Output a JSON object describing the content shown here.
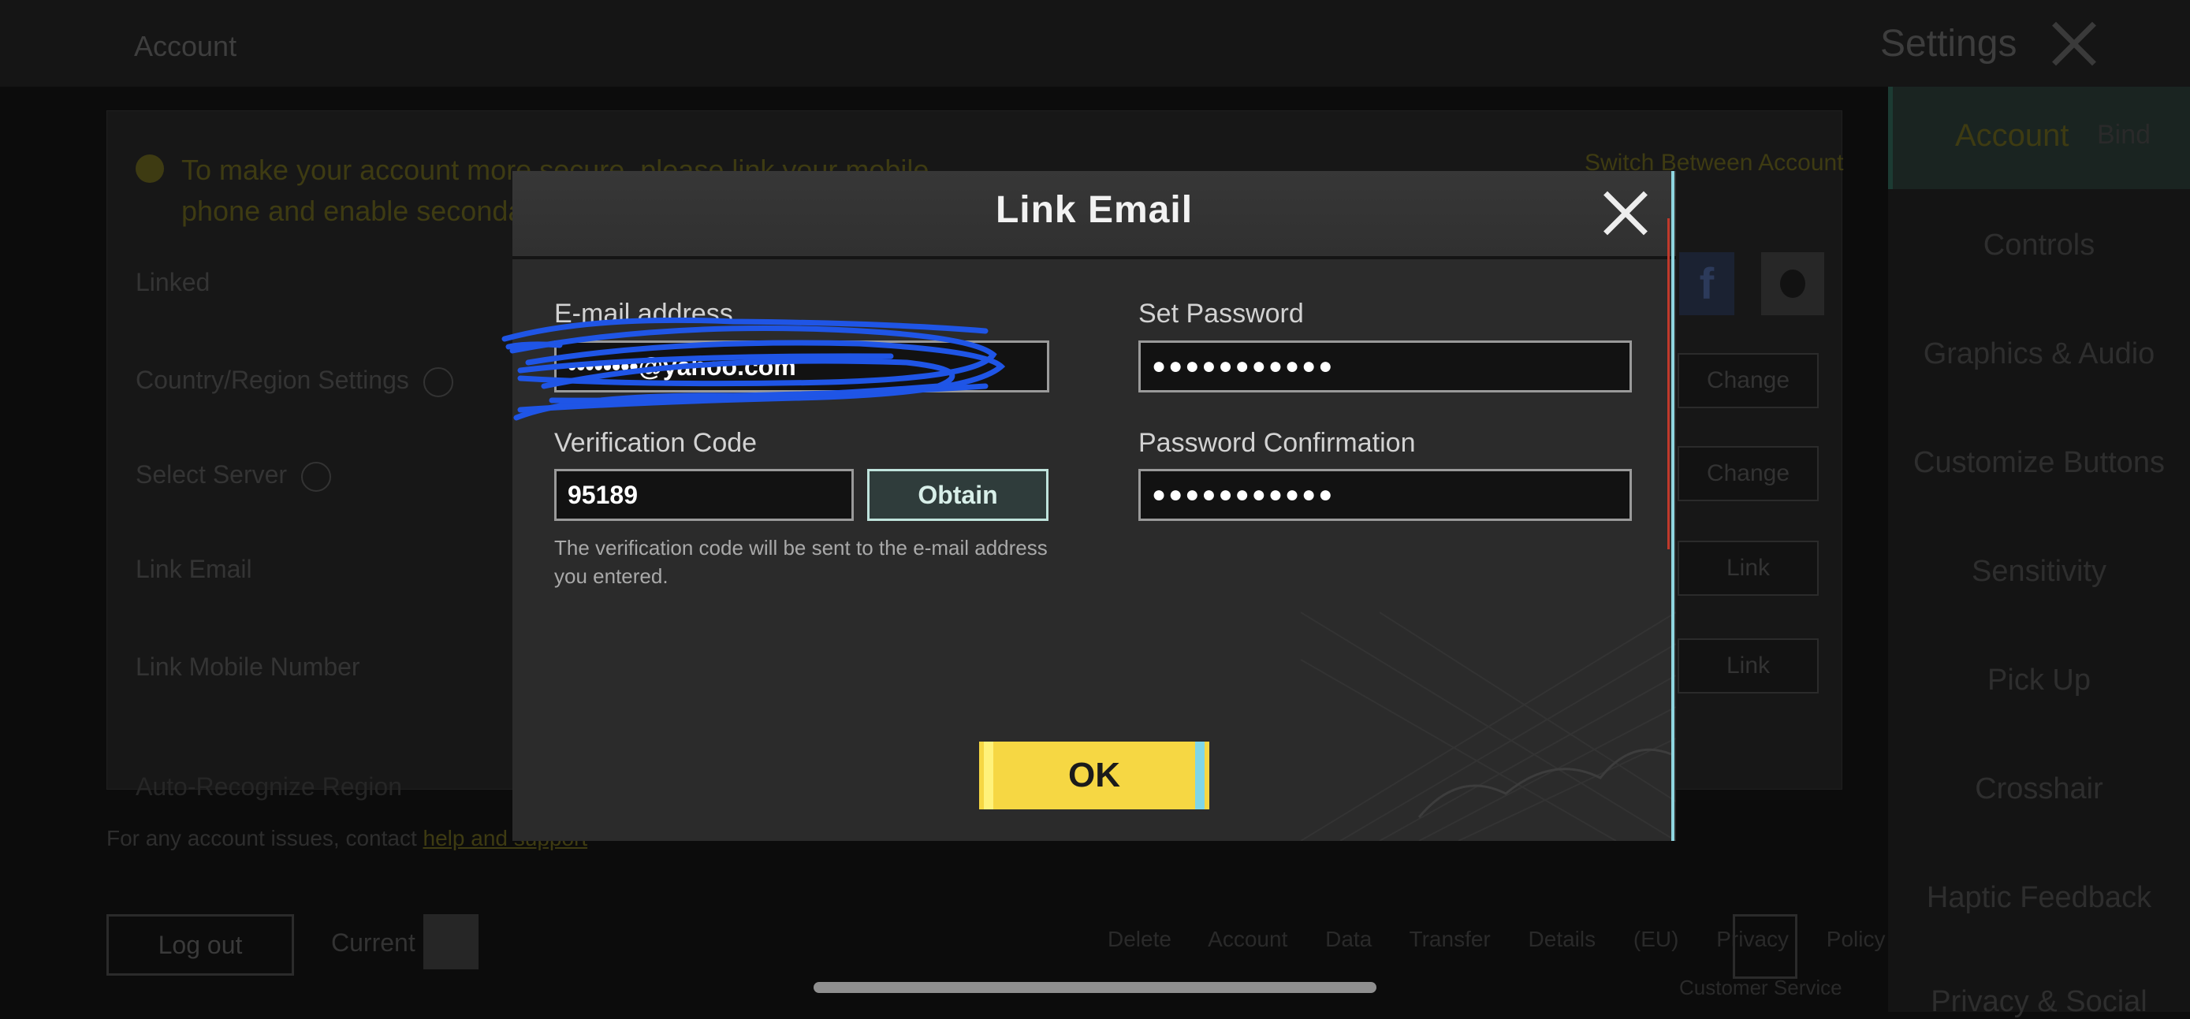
{
  "background": {
    "header_title": "Account",
    "settings_title": "Settings",
    "notice": "To make your account more secure, please link your mobile phone and enable secondary verification.",
    "switch_link": "Switch Between Account",
    "rows": {
      "linked": "Linked",
      "country_region": "Country/Region Settings",
      "select_server": "Select Server",
      "link_email": "Link Email",
      "link_mobile": "Link Mobile Number",
      "extra_row": "Auto-Recognize Region"
    },
    "buttons": {
      "change_1": "Change",
      "change_2": "Change",
      "link_1": "Link",
      "link_2": "Link"
    },
    "footer": {
      "text": "For any account issues, contact",
      "link": "help and support"
    },
    "log_out": "Log out",
    "current_label": "Current",
    "policy_links": "Delete Account Data Transfer Details (EU) Privacy Policy",
    "customer_service": "Customer Service",
    "sidebar": {
      "active": "Account",
      "active_tag": "Bind",
      "items": [
        "Controls",
        "Graphics & Audio",
        "Customize Buttons",
        "Sensitivity",
        "Pick Up",
        "Crosshair",
        "Haptic Feedback",
        "Privacy & Social"
      ]
    }
  },
  "dialog": {
    "title": "Link Email",
    "email_label": "E-mail address",
    "email_value": "••••••••@yahoo.com",
    "verification_label": "Verification Code",
    "verification_value": "95189",
    "obtain_label": "Obtain",
    "hint": "The verification code will be sent to the e-mail address you entered.",
    "set_password_label": "Set Password",
    "set_password_value": "●●●●●●●●●●●",
    "confirm_label": "Password Confirmation",
    "confirm_value": "●●●●●●●●●●●",
    "ok_label": "OK"
  },
  "colors": {
    "ok_button": "#f6d743",
    "obtain_border": "#bfe3dc",
    "redaction": "#1f55e6"
  },
  "icons": {
    "dialog_close": "close-icon",
    "settings_close": "close-icon",
    "facebook": "facebook-icon",
    "apple": "apple-icon"
  }
}
